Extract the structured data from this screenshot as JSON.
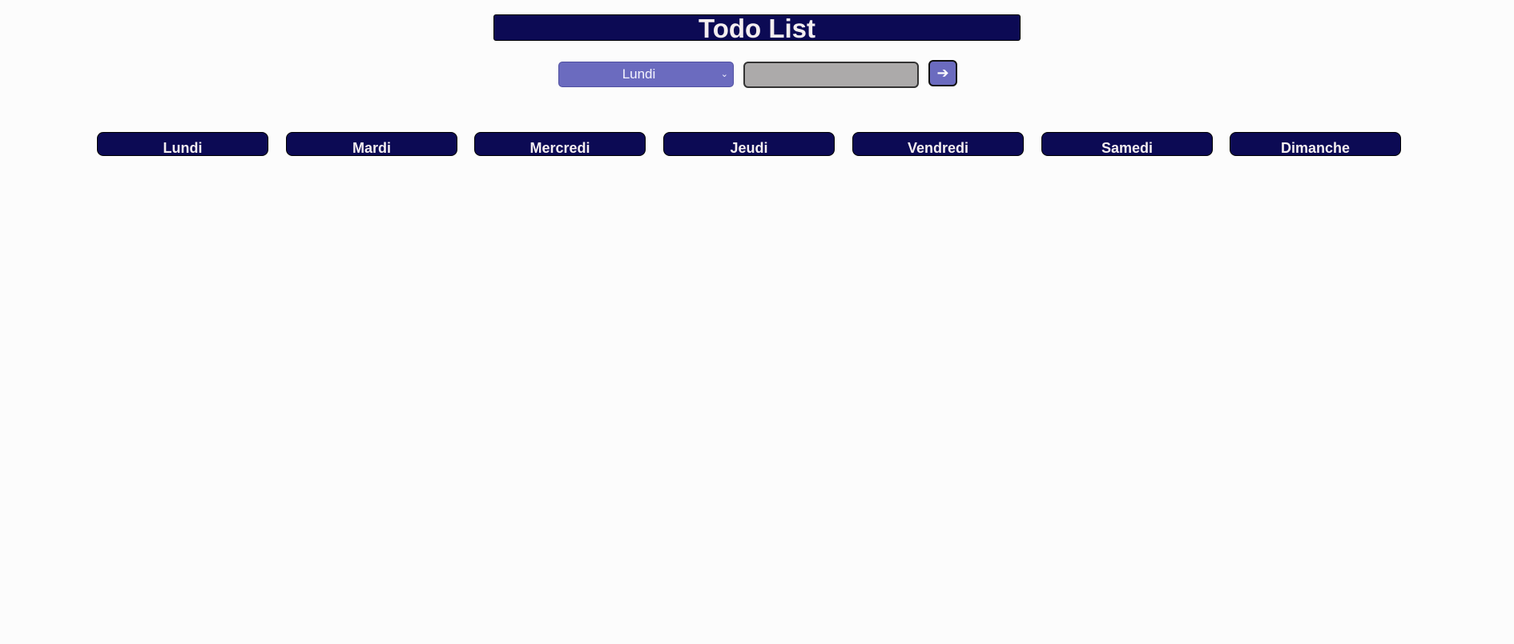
{
  "header": {
    "title": "Todo List"
  },
  "form": {
    "day_select": {
      "selected": "Lundi"
    },
    "task_input": {
      "value": "",
      "placeholder": ""
    },
    "submit_icon": "arrow-right-icon",
    "submit_glyph": "➔"
  },
  "days": [
    {
      "label": "Lundi"
    },
    {
      "label": "Mardi"
    },
    {
      "label": "Mercredi"
    },
    {
      "label": "Jeudi"
    },
    {
      "label": "Vendredi"
    },
    {
      "label": "Samedi"
    },
    {
      "label": "Dimanche"
    }
  ],
  "colors": {
    "background": "#fcfcfc",
    "header_bg": "#0c0a54",
    "header_text": "#f4eef0",
    "accent": "#6b6bbf",
    "input_bg": "#acaaaa"
  }
}
